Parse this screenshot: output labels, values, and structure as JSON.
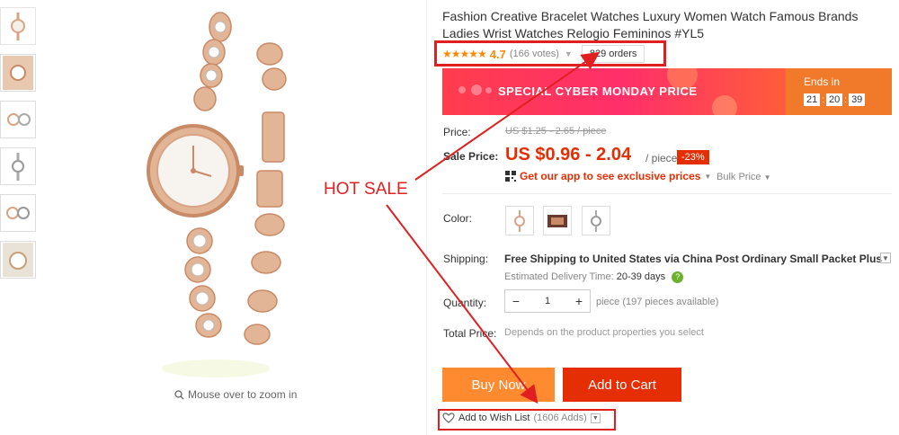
{
  "product": {
    "title": "Fashion Creative Bracelet Watches Luxury Women Watch Famous Brands Ladies Wrist Watches Relogio Femininos #YL5",
    "stars": "★★★★★",
    "rating": "4.7",
    "votes": "(166 votes)",
    "orders": "829 orders"
  },
  "banner": {
    "text": "SPECIAL CYBER MONDAY PRICE",
    "ends_in": "Ends in",
    "timer": [
      "21",
      "20",
      "39"
    ]
  },
  "pricing": {
    "price_label": "Price:",
    "price_old": "US $1.25 - 2.65 / piece",
    "sale_label": "Sale Price:",
    "sale_price": "US $0.96 - 2.04",
    "per_piece": "/ piece",
    "discount": "-23%",
    "app_promo": "Get our app to see exclusive prices",
    "bulk_price": "Bulk Price"
  },
  "options": {
    "color_label": "Color:",
    "shipping_label": "Shipping:",
    "shipping_text": "Free Shipping to United States via China Post Ordinary Small Packet Plus",
    "delivery_label": "Estimated Delivery Time:",
    "delivery_value": "20-39 days",
    "quantity_label": "Quantity:",
    "quantity_value": "1",
    "quantity_available": "piece (197 pieces available)",
    "total_label": "Total Price:",
    "total_value": "Depends on the product properties you select"
  },
  "actions": {
    "buy_now": "Buy Now",
    "add_to_cart": "Add to Cart",
    "wish_list": "Add to Wish List",
    "wish_adds": "(1606 Adds)"
  },
  "gallery": {
    "zoom_hint": "Mouse over to zoom in"
  },
  "annotation": {
    "hot_sale": "HOT SALE"
  },
  "colors": {
    "accent_red": "#e62e04",
    "buy_orange": "#ff8a30",
    "highlight_red": "#e02020",
    "rose_gold": "#d9a486"
  }
}
